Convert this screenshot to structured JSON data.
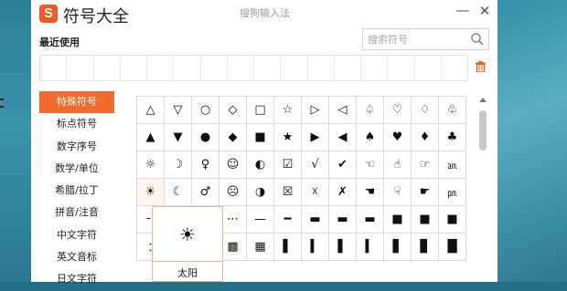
{
  "window": {
    "app_title": "符号大全",
    "ime_title": "搜狗输入法",
    "logo_letter": "S",
    "minimize_glyph": "—",
    "close_glyph": "✕"
  },
  "recent": {
    "label": "最近使用"
  },
  "search": {
    "placeholder": "搜索符号"
  },
  "sidebar": {
    "items": [
      {
        "label": "特殊符号"
      },
      {
        "label": "标点符号"
      },
      {
        "label": "数字序号"
      },
      {
        "label": "数学/单位"
      },
      {
        "label": "希腊/拉丁"
      },
      {
        "label": "拼音/注音"
      },
      {
        "label": "中文字符"
      },
      {
        "label": "英文音标"
      },
      {
        "label": "日文字符"
      }
    ]
  },
  "symbols": {
    "row1": [
      "△",
      "▽",
      "○",
      "◇",
      "□",
      "☆",
      "▷",
      "◁",
      "♤",
      "♡",
      "♢",
      "♧"
    ],
    "row2": [
      "▲",
      "▼",
      "●",
      "◆",
      "■",
      "★",
      "▶",
      "◀",
      "♠",
      "♥",
      "♦",
      "♣"
    ],
    "row3": [
      "☼",
      "☽",
      "♀",
      "☺",
      "◐",
      "☑",
      "√",
      "✔",
      "☜",
      "☝",
      "☞",
      "㏂"
    ],
    "row4": [
      "☀",
      "☾",
      "♂",
      "☹",
      "◑",
      "☒",
      "☓",
      "✗",
      "☚",
      "☟",
      "☛",
      "㏘"
    ],
    "row5": [
      "╴",
      "",
      "",
      "⋯",
      "—",
      "━",
      "▬",
      "▬",
      "▬",
      "■",
      "■",
      "■"
    ],
    "row6": [
      "︰",
      "",
      "",
      "▩",
      "▦",
      "▌",
      "▍",
      "▌",
      "▍",
      "▋",
      "▊",
      "█"
    ]
  },
  "tooltip": {
    "symbol": "☀",
    "name": "太阳"
  }
}
